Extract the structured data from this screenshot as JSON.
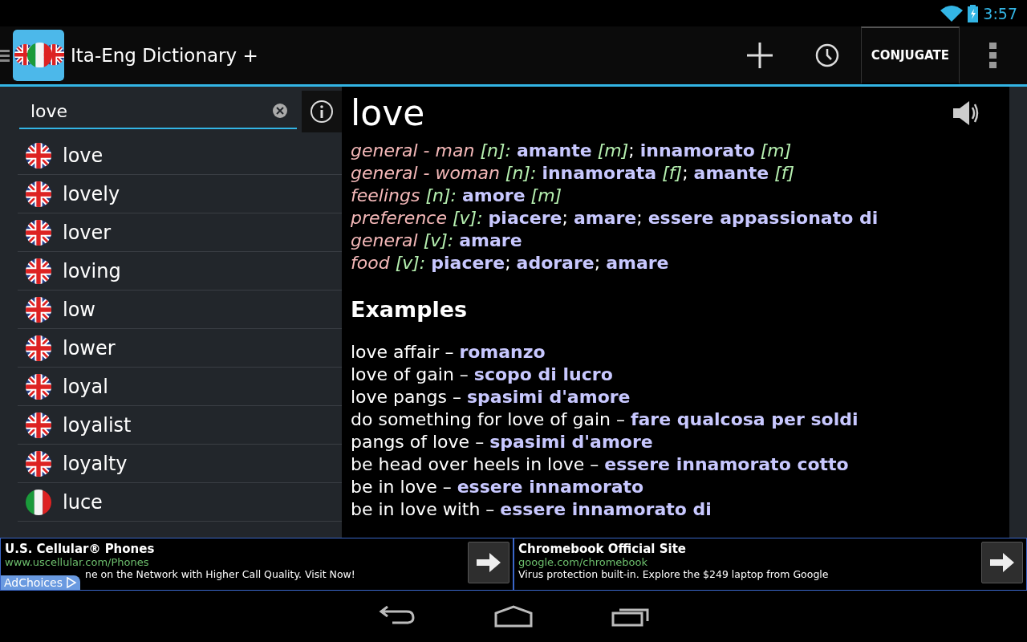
{
  "status_bar": {
    "time": "3:57"
  },
  "action_bar": {
    "title": "Ita-Eng Dictionary +",
    "conjugate": "CONJUGATE"
  },
  "search": {
    "value": "love"
  },
  "results": [
    {
      "word": "love",
      "kind": "english"
    },
    {
      "word": "lovely",
      "kind": "english"
    },
    {
      "word": "lover",
      "kind": "english"
    },
    {
      "word": "loving",
      "kind": "english"
    },
    {
      "word": "low",
      "kind": "english"
    },
    {
      "word": "lower",
      "kind": "english"
    },
    {
      "word": "loyal",
      "kind": "english"
    },
    {
      "word": "loyalist",
      "kind": "english"
    },
    {
      "word": "loyalty",
      "kind": "english"
    },
    {
      "word": "luce",
      "kind": "italian"
    }
  ],
  "entry": {
    "headword": "love",
    "senses": [
      {
        "context": "general - man",
        "pos": "[n]:",
        "translations": [
          {
            "text": "amante",
            "gender": "[m]",
            "sep": ";"
          },
          {
            "text": "innamorato",
            "gender": "[m]"
          }
        ]
      },
      {
        "context": "general - woman",
        "pos": "[n]:",
        "translations": [
          {
            "text": "innamorata",
            "gender": "[f]",
            "sep": ";"
          },
          {
            "text": "amante",
            "gender": "[f]"
          }
        ]
      },
      {
        "context": "feelings",
        "pos": "[n]:",
        "translations": [
          {
            "text": "amore",
            "gender": "[m]"
          }
        ]
      },
      {
        "context": "preference",
        "pos": "[v]:",
        "translations": [
          {
            "text": "piacere",
            "sep": ";"
          },
          {
            "text": "amare",
            "sep": ";"
          },
          {
            "text": "essere appassionato di"
          }
        ]
      },
      {
        "context": "general",
        "pos": "[v]:",
        "translations": [
          {
            "text": "amare"
          }
        ]
      },
      {
        "context": "food",
        "pos": "[v]:",
        "translations": [
          {
            "text": "piacere",
            "sep": ";"
          },
          {
            "text": "adorare",
            "sep": ";"
          },
          {
            "text": "amare"
          }
        ]
      }
    ],
    "examples_heading": "Examples",
    "examples": [
      {
        "phrase": "love affair –",
        "translation": "romanzo"
      },
      {
        "phrase": "love of gain –",
        "translation": "scopo di lucro"
      },
      {
        "phrase": "love pangs –",
        "translation": "spasimi d'amore"
      },
      {
        "phrase": "do something for love of gain –",
        "translation": "fare qualcosa per soldi"
      },
      {
        "phrase": "pangs of love –",
        "translation": "spasimi d'amore"
      },
      {
        "phrase": "be head over heels in love –",
        "translation": "essere innamorato cotto"
      },
      {
        "phrase": "be in love –",
        "translation": "essere innamorato"
      },
      {
        "phrase": "be in love with –",
        "translation": "essere innamorato di"
      }
    ]
  },
  "ads": [
    {
      "title": "U.S. Cellular® Phones",
      "url": "www.uscellular.com/Phones",
      "text": "ne on the Network with Higher Call Quality. Visit Now!",
      "adchoices": "AdChoices"
    },
    {
      "title": "Chromebook Official Site",
      "url": "google.com/chromebook",
      "text": "Virus protection built-in. Explore the $249 laptop from Google"
    }
  ]
}
